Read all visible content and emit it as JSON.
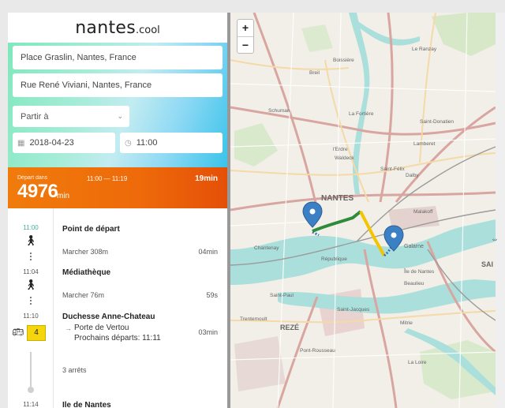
{
  "logo": {
    "main": "nantes",
    "suffix": ".cool"
  },
  "form": {
    "from": "Place Graslin, Nantes, France",
    "to": "Rue René Viviani, Nantes, France",
    "mode": "Partir à",
    "date": "2018-04-23",
    "time": "11:00"
  },
  "summary": {
    "departure_label": "Départ dans",
    "departure_value": "4976",
    "departure_unit": "min",
    "time_range": "11:00 — 11:19",
    "total": "19min",
    "accent": "#ee6a0a"
  },
  "steps": [
    {
      "time": "11:00",
      "title": "Point de départ",
      "sub": "Marcher 308m",
      "duration": "04min"
    },
    {
      "time": "11:04",
      "title": "Médiathèque",
      "sub": "Marcher 76m",
      "duration": "59s"
    },
    {
      "time": "11:10",
      "title": "Duchesse Anne-Chateau",
      "line": "4",
      "direction": "Porte de Vertou",
      "next": "Prochains départs: 11:11",
      "duration": "03min"
    },
    {
      "stops": "3 arrêts"
    },
    {
      "time": "11:14",
      "title": "Ile de Nantes"
    }
  ],
  "icons": {
    "walk": "pedestrian-icon",
    "bus": "bus-icon",
    "calendar": "calendar-icon",
    "clock": "clock-icon",
    "chevron": "chevron-down-icon",
    "arrow": "arrow-right-icon"
  },
  "map": {
    "zoom_in": "+",
    "zoom_out": "−",
    "labels": {
      "nantes": "NANTES",
      "reze": "REZÉ",
      "sainte_luce": "SAI",
      "gare": "Galarne",
      "ile": "Île de Nantes",
      "erdre": "l'Erdre",
      "loire": "La Loire",
      "saint_felix": "Saint-Félix",
      "malakoff": "Malakoff",
      "republique": "République",
      "beaulieu": "Beaulieu",
      "chantenay": "Chantenay",
      "waldeck": "Waldeck",
      "ranzay": "Le Ranzay",
      "schuman": "Schuman",
      "saint_paul": "Saint-Paul",
      "la_mitrie": "Mitrie",
      "lamberet": "Lamberet",
      "dalby": "Dalby",
      "breil": "Breil",
      "boissiere": "Boissière",
      "trentemoult": "Trentemoult",
      "pont_rousseau": "Pont-Rousseau",
      "saint_donatien": "Saint-Donatien",
      "la_fortiere": "La Fortière",
      "st_jacques": "Saint-Jacques"
    }
  }
}
